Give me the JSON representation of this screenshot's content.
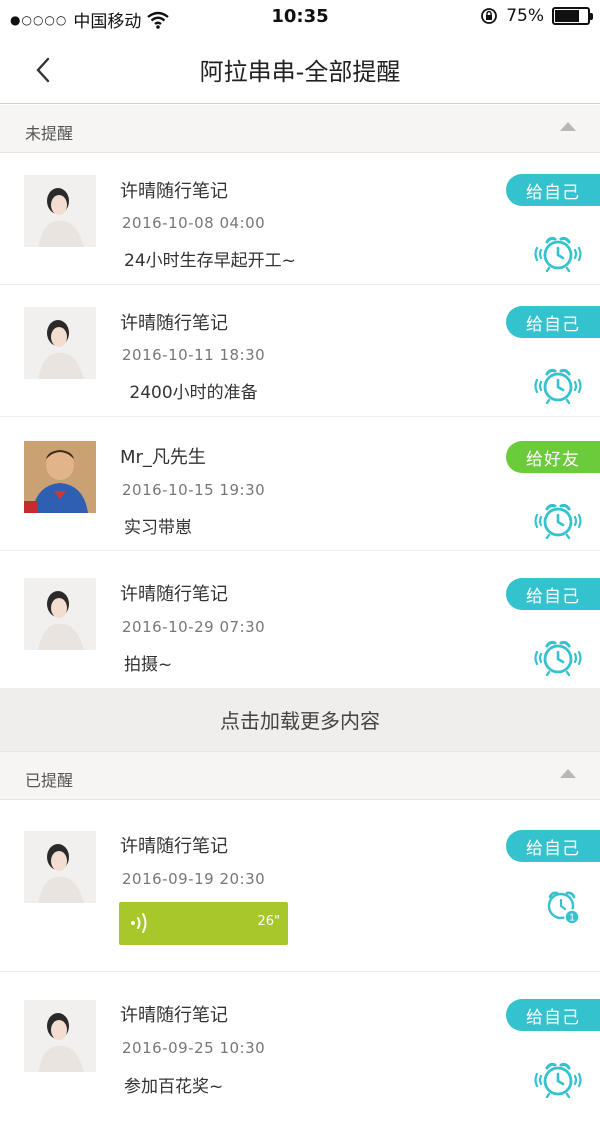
{
  "status_bar": {
    "signal": "●○○○○",
    "carrier": "中国移动",
    "time": "10:35",
    "battery": "75%",
    "battery_level": 0.75
  },
  "nav": {
    "title": "阿拉串串-全部提醒"
  },
  "sections": {
    "pending_label": "未提醒",
    "done_label": "已提醒"
  },
  "load_more": "点击加载更多内容",
  "pending_items": [
    {
      "name": "许晴随行笔记",
      "time": "2016-10-08  04:00",
      "message": "24小时生存早起开工~",
      "badge": "给自己",
      "badge_type": "self"
    },
    {
      "name": "许晴随行笔记",
      "time": "2016-10-11  18:30",
      "message": " 2400小时的准备",
      "badge": "给自己",
      "badge_type": "self"
    },
    {
      "name": "Mr_凡先生",
      "time": "2016-10-15  19:30",
      "message": "实习带崽",
      "badge": "给好友",
      "badge_type": "friend"
    },
    {
      "name": "许晴随行笔记",
      "time": "2016-10-29  07:30",
      "message": "拍摄~",
      "badge": "给自己",
      "badge_type": "self"
    }
  ],
  "done_items": [
    {
      "name": "许晴随行笔记",
      "time": "2016-09-19  20:30",
      "voice_duration": "26\"",
      "badge": "给自己",
      "alarm_count": "1"
    },
    {
      "name": "许晴随行笔记",
      "time": "2016-09-25  10:30",
      "message": "参加百花奖~",
      "badge": "给自己"
    }
  ],
  "colors": {
    "accent": "#35c2cf",
    "friend": "#6ccb3b",
    "voice": "#a7c72a"
  }
}
